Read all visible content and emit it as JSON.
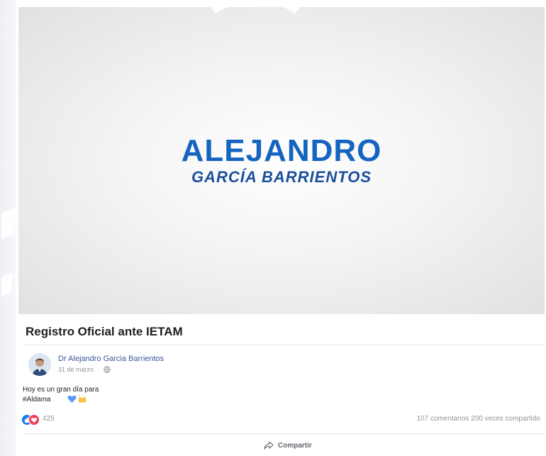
{
  "video": {
    "logo_line1": "ALEJANDRO",
    "logo_line2": "GARCÍA BARRIENTOS"
  },
  "post": {
    "title": "Registro Oficial ante IETAM",
    "author": "Dr Alejandro Garcia Barrientos",
    "date": "31 de marzo",
    "text_line1": "Hoy es un gran día para",
    "text_line2": "#Aldama",
    "reaction_count": "425",
    "stats": "107 comentarios  200 veces compartido",
    "share_label": "Compartir"
  },
  "icons": {
    "globe": "globe-icon",
    "like": "like-icon",
    "love": "love-icon",
    "share": "share-icon",
    "heart": "blue-heart-emoji",
    "hands": "raised-hands-emoji"
  },
  "colors": {
    "logo_blue": "#1565c0",
    "logo_dark_blue": "#1b4f9c",
    "link": "#385898",
    "like": "#1877f2",
    "love": "#f33e58"
  }
}
